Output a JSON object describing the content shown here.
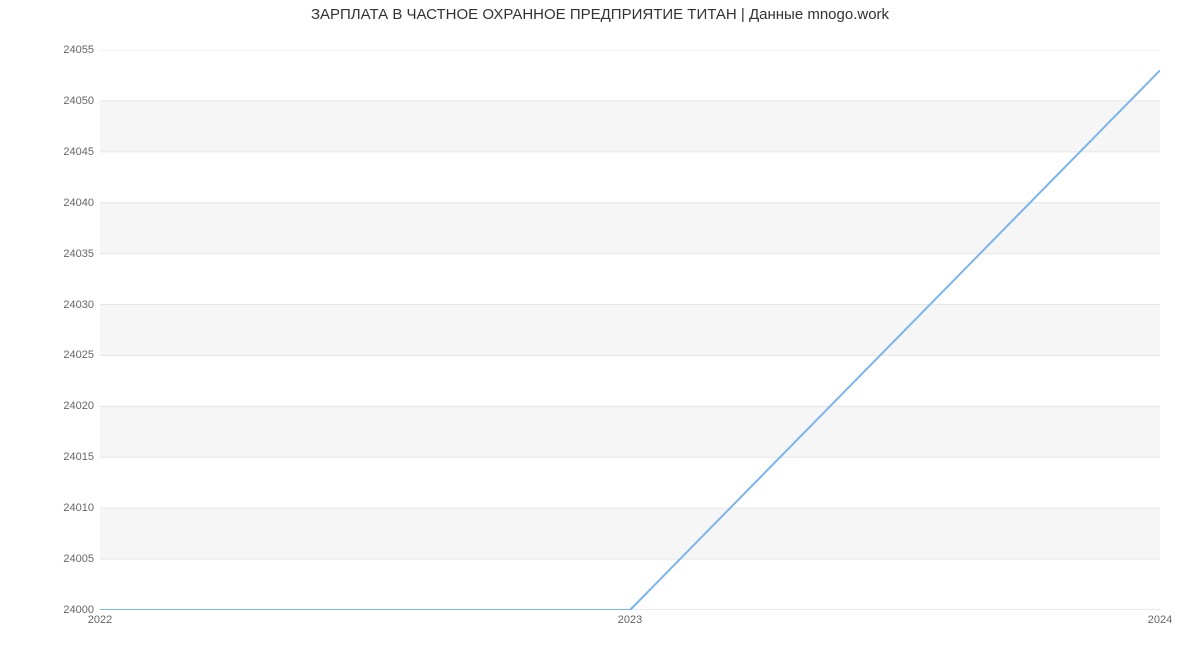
{
  "chart_data": {
    "type": "line",
    "title": "ЗАРПЛАТА В  ЧАСТНОЕ ОХРАННОЕ ПРЕДПРИЯТИЕ ТИТАН | Данные mnogo.work",
    "x": [
      2022,
      2023,
      2024
    ],
    "values": [
      24000,
      24000,
      24053
    ],
    "xlabel": "",
    "ylabel": "",
    "xlim": [
      2022,
      2024
    ],
    "ylim": [
      24000,
      24055
    ],
    "yticks": [
      24000,
      24005,
      24010,
      24015,
      24020,
      24025,
      24030,
      24035,
      24040,
      24045,
      24050,
      24055
    ],
    "xticks": [
      2022,
      2023,
      2024
    ],
    "line_color": "#7cb5ec",
    "band_color": "#f6f6f6",
    "grid_color": "#e6e6e6",
    "axis_color": "#ccd6eb",
    "tick_color": "#ccd6eb"
  }
}
